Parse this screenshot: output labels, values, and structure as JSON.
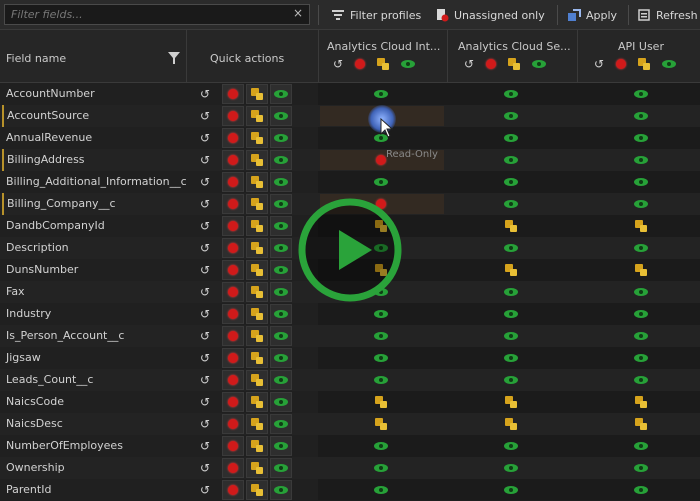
{
  "toolbar": {
    "search_placeholder": "Filter fields...",
    "clear_glyph": "×",
    "filter_profiles": "Filter profiles",
    "unassigned_only": "Unassigned only",
    "apply": "Apply",
    "refresh": "Refresh"
  },
  "grid": {
    "field_name_header": "Field name",
    "quick_actions_header": "Quick actions",
    "profiles": [
      "Analytics Cloud Int...",
      "Analytics Cloud Se...",
      "API User"
    ],
    "tooltip": "Read-Only",
    "rows": [
      {
        "name": "AccountNumber",
        "modified": false,
        "p": [
          "eye",
          "eye",
          "eye"
        ]
      },
      {
        "name": "AccountSource",
        "modified": true,
        "p": [
          "cursor",
          "eye",
          "eye"
        ]
      },
      {
        "name": "AnnualRevenue",
        "modified": false,
        "p": [
          "eye",
          "eye",
          "eye"
        ]
      },
      {
        "name": "BillingAddress",
        "modified": true,
        "p": [
          "red",
          "eye",
          "eye"
        ]
      },
      {
        "name": "Billing_Additional_Information__c",
        "modified": false,
        "p": [
          "eye",
          "eye",
          "eye"
        ]
      },
      {
        "name": "Billing_Company__c",
        "modified": true,
        "p": [
          "red",
          "eye",
          "eye"
        ]
      },
      {
        "name": "DandbCompanyId",
        "modified": false,
        "p": [
          "key",
          "key",
          "key"
        ]
      },
      {
        "name": "Description",
        "modified": false,
        "p": [
          "eye",
          "eye",
          "eye"
        ]
      },
      {
        "name": "DunsNumber",
        "modified": false,
        "p": [
          "key",
          "key",
          "key"
        ]
      },
      {
        "name": "Fax",
        "modified": false,
        "p": [
          "eye",
          "eye",
          "eye"
        ]
      },
      {
        "name": "Industry",
        "modified": false,
        "p": [
          "eye",
          "eye",
          "eye"
        ]
      },
      {
        "name": "Is_Person_Account__c",
        "modified": false,
        "p": [
          "eye",
          "eye",
          "eye"
        ]
      },
      {
        "name": "Jigsaw",
        "modified": false,
        "p": [
          "eye",
          "eye",
          "eye"
        ]
      },
      {
        "name": "Leads_Count__c",
        "modified": false,
        "p": [
          "eye",
          "eye",
          "eye"
        ]
      },
      {
        "name": "NaicsCode",
        "modified": false,
        "p": [
          "key",
          "key",
          "key"
        ]
      },
      {
        "name": "NaicsDesc",
        "modified": false,
        "p": [
          "key",
          "key",
          "key"
        ]
      },
      {
        "name": "NumberOfEmployees",
        "modified": false,
        "p": [
          "eye",
          "eye",
          "eye"
        ]
      },
      {
        "name": "Ownership",
        "modified": false,
        "p": [
          "eye",
          "eye",
          "eye"
        ]
      },
      {
        "name": "ParentId",
        "modified": false,
        "p": [
          "eye",
          "eye",
          "eye"
        ]
      }
    ]
  },
  "colors": {
    "accent_green": "#27a138",
    "red": "#d11a1a",
    "key_gold": "#d6a31c",
    "play_green": "#2aa33a"
  },
  "icons": {
    "undo": "↺"
  }
}
